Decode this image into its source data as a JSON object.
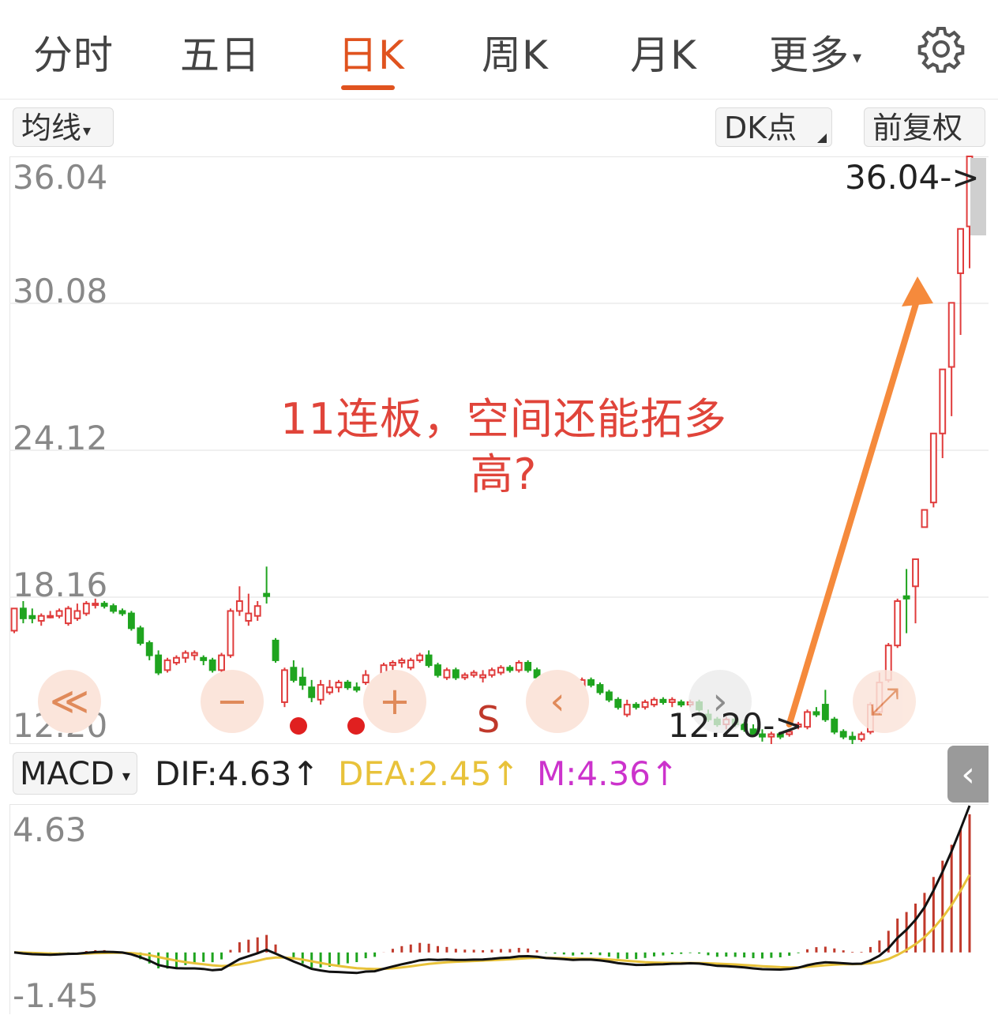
{
  "tabs": [
    {
      "label": "分时",
      "active": false
    },
    {
      "label": "五日",
      "active": false
    },
    {
      "label": "日K",
      "active": true
    },
    {
      "label": "周K",
      "active": false
    },
    {
      "label": "月K",
      "active": false
    },
    {
      "label": "更多",
      "active": false
    }
  ],
  "tab_more_caret": "▾",
  "toolbar": {
    "ma_label": "均线",
    "ma_caret": "▾",
    "dk_label": "DK点",
    "adjust_label": "前复权"
  },
  "chart_data": {
    "type": "candlestick",
    "price_axis": {
      "ticks": [
        "36.04",
        "30.08",
        "24.12",
        "18.16",
        "12.20"
      ],
      "ylim": [
        12.2,
        36.04
      ]
    },
    "high_marker": "36.04->",
    "low_marker": "12.20->",
    "annotation": "11连板，空间还能拓多高?",
    "colors": {
      "up": "#e03c3c",
      "down": "#1fa41f",
      "arrow": "#f58a3c",
      "dif": "#111111",
      "dea": "#e8c23a",
      "macd_bar_up": "#c0392b",
      "macd_bar_down": "#1fa41f"
    },
    "candles": [
      [
        16.8,
        17.7,
        16.7,
        17.7
      ],
      [
        17.7,
        18.0,
        17.1,
        17.3
      ],
      [
        17.4,
        17.7,
        17.1,
        17.3
      ],
      [
        17.2,
        17.5,
        17.0,
        17.4
      ],
      [
        17.4,
        17.6,
        17.3,
        17.4
      ],
      [
        17.4,
        17.7,
        17.3,
        17.6
      ],
      [
        17.1,
        17.8,
        17.0,
        17.7
      ],
      [
        17.3,
        17.9,
        17.2,
        17.6
      ],
      [
        17.5,
        18.0,
        17.4,
        17.9
      ],
      [
        17.9,
        18.1,
        17.7,
        17.9
      ],
      [
        17.9,
        18.0,
        17.7,
        17.8
      ],
      [
        17.8,
        17.9,
        17.5,
        17.6
      ],
      [
        17.6,
        17.7,
        17.4,
        17.5
      ],
      [
        17.5,
        17.6,
        16.8,
        16.9
      ],
      [
        16.9,
        17.0,
        16.2,
        16.3
      ],
      [
        16.3,
        16.4,
        15.6,
        15.8
      ],
      [
        15.8,
        16.0,
        15.0,
        15.1
      ],
      [
        15.2,
        15.7,
        15.1,
        15.6
      ],
      [
        15.5,
        15.8,
        15.4,
        15.7
      ],
      [
        15.7,
        16.0,
        15.5,
        15.9
      ],
      [
        15.8,
        16.0,
        15.6,
        15.9
      ],
      [
        15.7,
        15.8,
        15.4,
        15.6
      ],
      [
        15.6,
        15.7,
        15.1,
        15.2
      ],
      [
        15.2,
        15.9,
        15.1,
        15.8
      ],
      [
        15.8,
        17.7,
        15.7,
        17.6
      ],
      [
        17.6,
        18.6,
        17.4,
        18.0
      ],
      [
        17.2,
        18.3,
        17.0,
        17.5
      ],
      [
        17.4,
        18.0,
        17.2,
        17.8
      ],
      [
        18.3,
        19.4,
        17.9,
        18.2
      ],
      [
        16.4,
        16.5,
        15.5,
        15.6
      ],
      [
        13.9,
        15.3,
        13.7,
        15.2
      ],
      [
        15.3,
        15.6,
        14.7,
        14.8
      ],
      [
        14.9,
        15.3,
        14.4,
        14.6
      ],
      [
        14.5,
        14.8,
        13.9,
        14.1
      ],
      [
        14.0,
        14.8,
        13.8,
        14.6
      ],
      [
        14.3,
        14.8,
        14.2,
        14.5
      ],
      [
        14.5,
        14.8,
        14.3,
        14.7
      ],
      [
        14.7,
        14.8,
        14.4,
        14.5
      ],
      [
        14.5,
        14.7,
        14.3,
        14.4
      ],
      [
        14.7,
        15.2,
        14.6,
        15.0
      ],
      [
        14.6,
        14.7,
        14.5,
        14.6
      ],
      [
        15.0,
        15.5,
        14.9,
        15.4
      ],
      [
        15.4,
        15.6,
        15.2,
        15.5
      ],
      [
        15.5,
        15.7,
        15.3,
        15.6
      ],
      [
        15.3,
        15.7,
        15.2,
        15.6
      ],
      [
        15.6,
        15.9,
        15.5,
        15.8
      ],
      [
        15.8,
        16.0,
        15.3,
        15.4
      ],
      [
        15.4,
        15.5,
        14.9,
        15.0
      ],
      [
        14.9,
        15.3,
        14.8,
        15.2
      ],
      [
        15.2,
        15.3,
        14.8,
        14.9
      ],
      [
        14.9,
        15.1,
        14.8,
        15.0
      ],
      [
        15.0,
        15.2,
        14.9,
        15.1
      ],
      [
        14.9,
        15.2,
        14.7,
        15.0
      ],
      [
        15.0,
        15.3,
        14.9,
        15.2
      ],
      [
        15.1,
        15.4,
        15.0,
        15.3
      ],
      [
        15.3,
        15.4,
        15.1,
        15.2
      ],
      [
        15.2,
        15.6,
        15.1,
        15.5
      ],
      [
        15.5,
        15.6,
        15.1,
        15.2
      ],
      [
        15.2,
        15.3,
        14.8,
        14.9
      ],
      [
        14.9,
        15.0,
        14.4,
        14.5
      ],
      [
        14.5,
        14.8,
        14.3,
        14.7
      ],
      [
        14.7,
        14.8,
        14.5,
        14.6
      ],
      [
        14.6,
        14.7,
        14.3,
        14.4
      ],
      [
        14.4,
        14.9,
        14.3,
        14.8
      ],
      [
        14.8,
        14.9,
        14.5,
        14.6
      ],
      [
        14.6,
        14.7,
        14.2,
        14.3
      ],
      [
        14.3,
        14.4,
        13.9,
        14.0
      ],
      [
        14.0,
        14.1,
        13.6,
        13.7
      ],
      [
        13.4,
        14.0,
        13.3,
        13.8
      ],
      [
        13.8,
        13.9,
        13.6,
        13.7
      ],
      [
        13.7,
        14.0,
        13.6,
        13.9
      ],
      [
        13.8,
        14.1,
        13.7,
        14.0
      ],
      [
        14.0,
        14.1,
        13.8,
        13.9
      ],
      [
        13.9,
        14.1,
        13.7,
        14.0
      ],
      [
        13.9,
        14.0,
        13.7,
        13.8
      ],
      [
        13.8,
        14.0,
        13.7,
        13.9
      ],
      [
        13.9,
        14.0,
        13.5,
        13.6
      ],
      [
        13.4,
        13.6,
        13.1,
        13.2
      ],
      [
        13.2,
        13.3,
        12.9,
        13.0
      ],
      [
        13.0,
        13.3,
        12.8,
        13.2
      ],
      [
        13.2,
        13.4,
        12.9,
        13.0
      ],
      [
        13.0,
        13.2,
        12.7,
        12.8
      ],
      [
        12.8,
        13.0,
        12.5,
        12.6
      ],
      [
        12.6,
        12.8,
        12.3,
        12.5
      ],
      [
        12.5,
        12.7,
        12.2,
        12.6
      ],
      [
        12.6,
        12.7,
        12.4,
        12.5
      ],
      [
        12.6,
        12.8,
        12.5,
        12.7
      ],
      [
        12.9,
        13.1,
        12.8,
        13.0
      ],
      [
        12.9,
        13.6,
        12.8,
        13.5
      ],
      [
        13.5,
        13.7,
        13.3,
        13.4
      ],
      [
        13.8,
        14.4,
        13.1,
        13.2
      ],
      [
        13.2,
        13.3,
        12.6,
        12.7
      ],
      [
        12.7,
        12.8,
        12.4,
        12.5
      ],
      [
        12.5,
        12.7,
        12.2,
        12.4
      ],
      [
        12.4,
        12.7,
        12.3,
        12.6
      ],
      [
        12.7,
        13.9,
        12.6,
        13.8
      ],
      [
        13.5,
        15.1,
        13.4,
        14.7
      ],
      [
        14.8,
        16.3,
        14.7,
        16.2
      ],
      [
        16.2,
        18.1,
        16.1,
        18.0
      ],
      [
        18.2,
        19.3,
        16.7,
        18.1
      ],
      [
        18.6,
        19.7,
        17.1,
        19.7
      ],
      [
        21.0,
        21.7,
        21.0,
        21.7
      ],
      [
        22.0,
        24.8,
        21.8,
        24.8
      ],
      [
        24.8,
        27.4,
        23.8,
        27.4
      ],
      [
        27.5,
        30.1,
        25.5,
        30.1
      ],
      [
        31.3,
        33.1,
        28.8,
        33.1
      ],
      [
        33.2,
        36.04,
        31.5,
        36.04
      ]
    ],
    "macd": {
      "axis": {
        "ticks": [
          "4.63",
          "-1.45"
        ],
        "ylim": [
          -1.45,
          4.63
        ]
      },
      "dif": 4.63,
      "dea": 2.45,
      "m": 4.36
    }
  },
  "controls": {
    "rewind": "≪",
    "zoom_out": "−",
    "zoom_in": "+",
    "prev": "‹",
    "next": "›",
    "expand": "⤢",
    "s_label": "S"
  },
  "macd_header": {
    "chip_label": "MACD",
    "chip_caret": "▾",
    "dif": "DIF:4.63↑",
    "dea": "DEA:2.45↑",
    "m": "M:4.36↑"
  },
  "collapse_glyph": "‹"
}
